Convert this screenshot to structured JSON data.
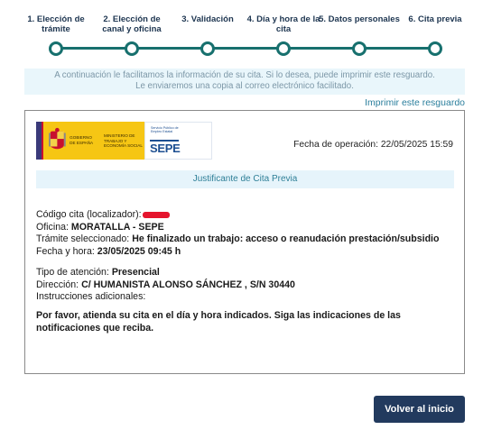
{
  "stepper": {
    "steps": [
      {
        "label": "1. Elección de trámite"
      },
      {
        "label": "2. Elección de canal y oficina"
      },
      {
        "label": "3. Validación"
      },
      {
        "label": "4. Día y hora de la cita"
      },
      {
        "label": "5. Datos personales"
      },
      {
        "label": "6. Cita previa"
      }
    ],
    "accent_color": "#17706e"
  },
  "banner": {
    "line1": "A continuación le facilitamos la información de su cita. Si lo desea, puede imprimir este resguardo.",
    "line2": "Le enviaremos una copia al correo electrónico facilitado."
  },
  "print_link": "Imprimir este resguardo",
  "receipt": {
    "logo": {
      "gov_text": "Gobierno de España",
      "ministry_text": "Ministerio de Trabajo y Economía Social",
      "sepe_subtitle": "Servicio Público de Empleo Estatal",
      "sepe_word": "SEPE"
    },
    "operation_date": "Fecha de operación: 22/05/2025 15:59",
    "title": "Justificante de Cita Previa",
    "fields": {
      "codigo_label": "Código cita (localizador):",
      "oficina_label": "Oficina:",
      "oficina_value": "MORATALLA - SEPE",
      "tramite_label": "Trámite seleccionado:",
      "tramite_value": "He finalizado un trabajo: acceso o reanudación prestación/subsidio",
      "fecha_label": "Fecha y hora:",
      "fecha_value": "23/05/2025 09:45 h",
      "tipo_label": "Tipo de atención:",
      "tipo_value": "Presencial",
      "direccion_label": "Dirección:",
      "direccion_value": "C/ HUMANISTA ALONSO SÁNCHEZ , S/N 30440",
      "instrucciones_label": "Instrucciones adicionales:"
    },
    "notice": "Por favor, atienda su cita en el día y hora indicados. Siga las indicaciones de las notificaciones que reciba."
  },
  "back_button": "Volver al inicio",
  "colors": {
    "primary_button": "#223a5e",
    "banner_bg": "#e9f6fb",
    "link": "#2a7e9c",
    "redaction": "#e5142d"
  }
}
